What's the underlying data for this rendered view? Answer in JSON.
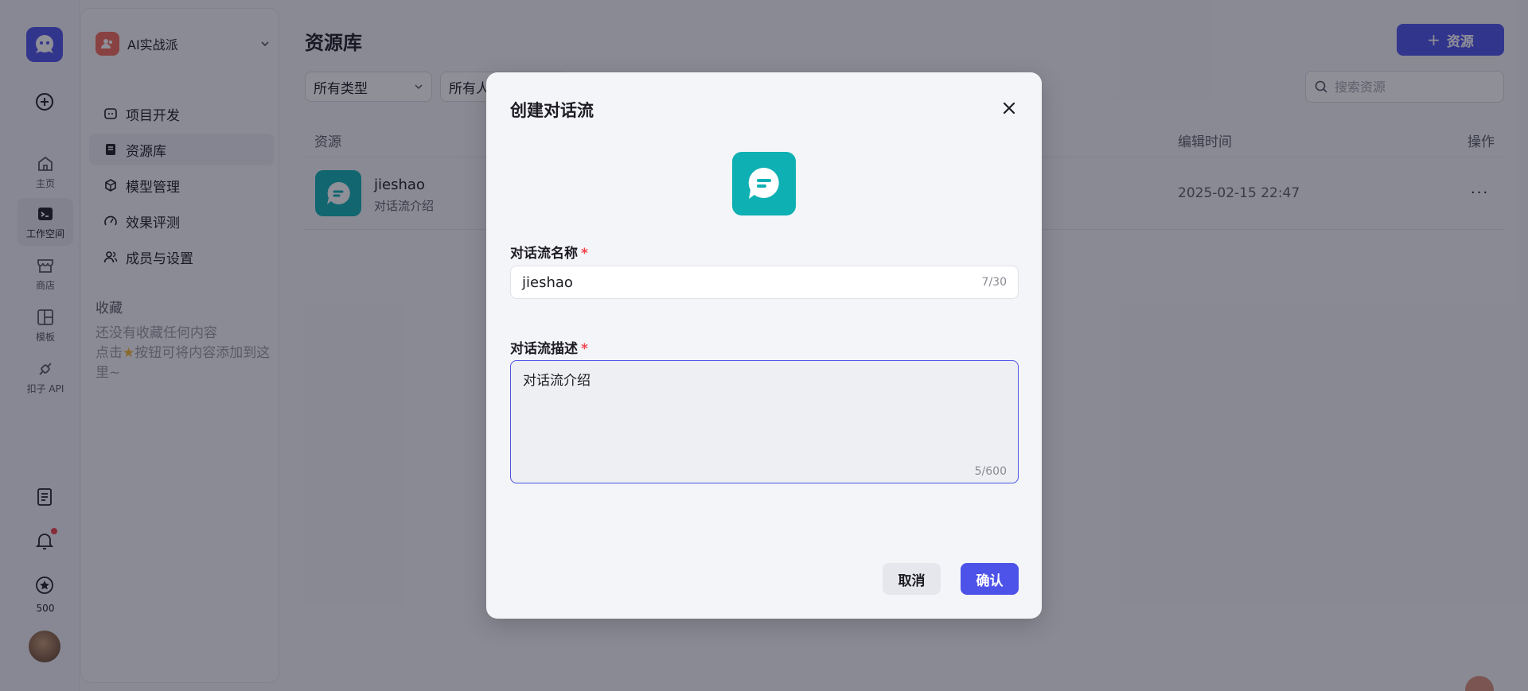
{
  "rail": {
    "items": [
      {
        "label": "主页",
        "icon": "home-icon"
      },
      {
        "label": "工作空间",
        "icon": "workspace-icon"
      },
      {
        "label": "商店",
        "icon": "store-icon"
      },
      {
        "label": "模板",
        "icon": "template-icon"
      },
      {
        "label": "扣子 API",
        "icon": "api-icon"
      }
    ],
    "credits": "500"
  },
  "sidebar": {
    "workspace_name": "AI实战派",
    "nav": [
      {
        "label": "项目开发",
        "icon": "project-icon"
      },
      {
        "label": "资源库",
        "icon": "library-icon"
      },
      {
        "label": "模型管理",
        "icon": "model-icon"
      },
      {
        "label": "效果评测",
        "icon": "evaluation-icon"
      },
      {
        "label": "成员与设置",
        "icon": "members-icon"
      }
    ],
    "favorites_title": "收藏",
    "favorites_empty_line1": "还没有收藏任何内容",
    "favorites_empty_line2_prefix": "点击",
    "favorites_empty_line2_suffix": "按钮可将内容添加到这里~"
  },
  "main": {
    "title": "资源库",
    "add_button": "资源",
    "filters": [
      "所有类型",
      "所有人"
    ],
    "search_placeholder": "搜索资源",
    "columns": {
      "resource": "资源",
      "edit_time": "编辑时间",
      "actions": "操作"
    },
    "rows": [
      {
        "name": "jieshao",
        "desc": "对话流介绍",
        "edit_time": "2025-02-15 22:47",
        "more": "···"
      }
    ]
  },
  "dialog": {
    "title": "创建对话流",
    "name_label": "对话流名称",
    "name_value": "jieshao",
    "name_counter": "7/30",
    "desc_label": "对话流描述",
    "desc_value": "对话流介绍",
    "desc_counter": "5/600",
    "required_mark": "*",
    "cancel": "取消",
    "confirm": "确认"
  },
  "colors": {
    "accent": "#4d53e8",
    "teal": "#0fb0b3",
    "required": "#f0444a"
  }
}
